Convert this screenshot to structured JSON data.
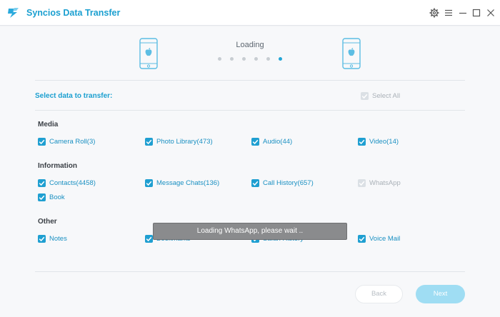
{
  "app": {
    "title": "Syncios Data Transfer"
  },
  "window_controls": [
    "gear-icon",
    "menu-icon",
    "minimize-icon",
    "maximize-icon",
    "close-icon"
  ],
  "progress": {
    "label": "Loading",
    "dot_count": 6,
    "active_dot": 6
  },
  "selection": {
    "title": "Select data to transfer:",
    "select_all_label": "Select All",
    "select_all_checked": true,
    "select_all_enabled": false
  },
  "sections": {
    "media": {
      "title": "Media",
      "items": [
        {
          "label": "Camera Roll(3)",
          "checked": true,
          "enabled": true
        },
        {
          "label": "Photo Library(473)",
          "checked": true,
          "enabled": true
        },
        {
          "label": "Audio(44)",
          "checked": true,
          "enabled": true
        },
        {
          "label": "Video(14)",
          "checked": true,
          "enabled": true
        }
      ]
    },
    "information": {
      "title": "Information",
      "items": [
        {
          "label": "Contacts(4458)",
          "checked": true,
          "enabled": true
        },
        {
          "label": "Message Chats(136)",
          "checked": true,
          "enabled": true
        },
        {
          "label": "Call History(657)",
          "checked": true,
          "enabled": true
        },
        {
          "label": "WhatsApp",
          "checked": true,
          "enabled": false
        },
        {
          "label": "Book",
          "checked": true,
          "enabled": true
        }
      ]
    },
    "other": {
      "title": "Other",
      "items": [
        {
          "label": "Notes",
          "checked": true,
          "enabled": true
        },
        {
          "label": "Bookmarks",
          "checked": true,
          "enabled": true
        },
        {
          "label": "Safari History",
          "checked": true,
          "enabled": true
        },
        {
          "label": "Voice Mail",
          "checked": true,
          "enabled": true
        }
      ]
    }
  },
  "toast": {
    "message": "Loading WhatsApp, please wait .."
  },
  "buttons": {
    "back_label": "Back",
    "next_label": "Next"
  },
  "colors": {
    "accent": "#1f9fd1",
    "disabled_text": "#aab1b8",
    "next_button": "#9fddf3",
    "toast_bg": "#8a8b8d"
  }
}
